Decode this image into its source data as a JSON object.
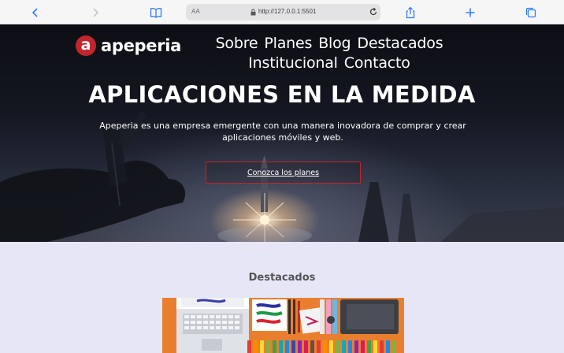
{
  "browser": {
    "text_size_label": "AA",
    "url": "http://127.0.0.1:5501",
    "icons": [
      "chevron-left-icon",
      "chevron-right-icon",
      "book-icon",
      "lock-icon",
      "reload-icon",
      "share-icon",
      "plus-icon",
      "tabs-icon"
    ]
  },
  "site": {
    "logo_letter": "a",
    "logo_text": "apeperia",
    "brand_color": "#c0262b"
  },
  "nav": {
    "items": [
      "Sobre",
      "Planes",
      "Blog",
      "Destacados",
      "Institucional",
      "Contacto"
    ]
  },
  "hero": {
    "title": "APLICACIONES EN LA MEDIDA",
    "subtitle": "Apeperia es una empresa emergente con una manera inovadora de comprar y crear aplicaciones móviles y web.",
    "cta_label": "Conozca los planes"
  },
  "featured": {
    "title": "Destacados",
    "background_color": "#e6e6f6"
  }
}
